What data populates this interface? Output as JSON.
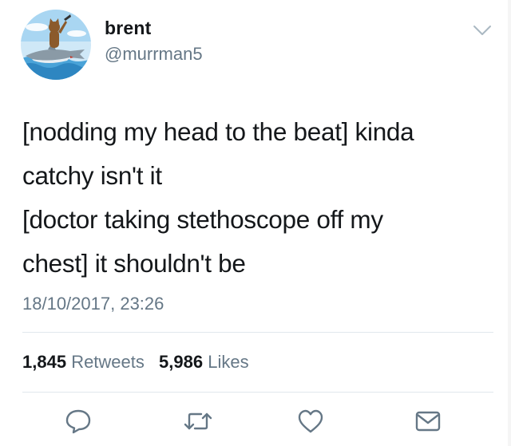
{
  "user": {
    "display_name": "brent",
    "handle": "@murrman5",
    "avatar_icon": "avatar-cat-riding-shark"
  },
  "tweet": {
    "lines": [
      "[nodding my head to the beat] kinda",
      "catchy isn't it",
      "[doctor taking stethoscope off my",
      "chest] it shouldn't be"
    ],
    "timestamp": "18/10/2017, 23:26"
  },
  "stats": {
    "retweets_count": "1,845",
    "retweets_label": "Retweets",
    "likes_count": "5,986",
    "likes_label": "Likes"
  },
  "actions": [
    {
      "name": "reply",
      "icon": "speech-bubble-icon"
    },
    {
      "name": "retweet",
      "icon": "retweet-icon"
    },
    {
      "name": "like",
      "icon": "heart-icon"
    },
    {
      "name": "message",
      "icon": "envelope-icon"
    }
  ],
  "colors": {
    "text": "#14171a",
    "secondary": "#657786",
    "divider": "#e1e8ed",
    "action_icon": "#657786"
  }
}
